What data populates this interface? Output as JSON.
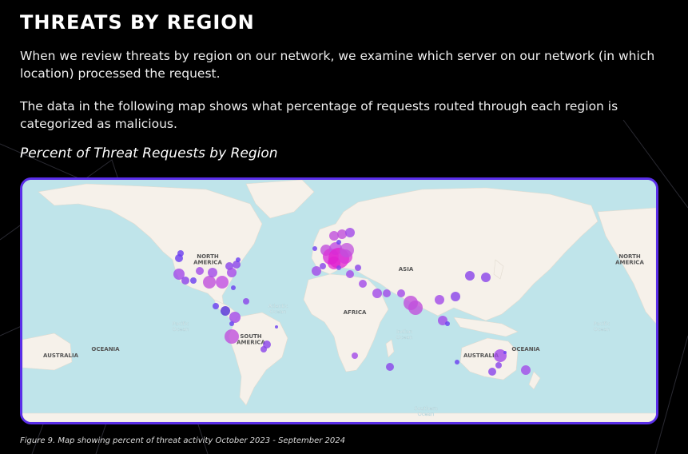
{
  "header": {
    "title": "THREATS BY REGION"
  },
  "intro": {
    "paragraph1": "When we review threats by region on our network, we examine which server on our network (in which location) processed the request.",
    "paragraph2": "The data in the following map shows what percentage of requests routed through each region is categorized as malicious."
  },
  "map": {
    "subtitle": "Percent of Threat Requests by Region",
    "labels": {
      "north_america": "NORTH\nAMERICA",
      "north_america_east": "NORTH\nAMERICA",
      "south_america": "SOUTH\nAMERICA",
      "africa": "AFRICA",
      "asia": "ASIA",
      "australia": "AUSTRALIA",
      "australia_west": "AUSTRALIA",
      "oceania": "OCEANIA",
      "oceania_west": "OCEANIA",
      "atlantic": "Atlantic\nOcean",
      "pacific_west": "Pacific\nOcean",
      "pacific_east": "Pacific\nOcean",
      "indian": "Indian\nOcean",
      "southern": "Southern\nOcean"
    },
    "colors": {
      "water": "#bfe4ea",
      "land": "#f6f1ea",
      "marker_low": "#6a3df0",
      "marker_high": "#e020d0",
      "frame": "#5a2ee8"
    }
  },
  "caption": "Figure 9.  Map showing percent of threat activity October 2023 - September 2024"
}
